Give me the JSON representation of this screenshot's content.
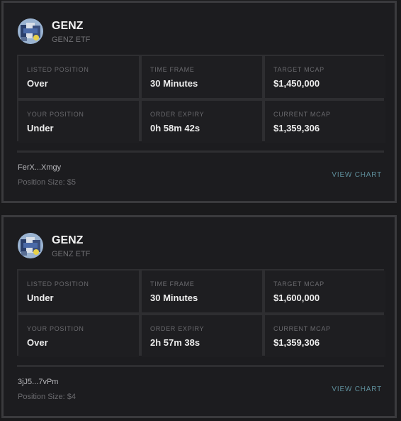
{
  "cards": [
    {
      "name": "GENZ",
      "subtitle": "GENZ ETF",
      "listed_position_label": "LISTED POSITION",
      "listed_position": "Over",
      "time_frame_label": "TIME FRAME",
      "time_frame": "30 Minutes",
      "target_mcap_label": "TARGET MCAP",
      "target_mcap": "$1,450,000",
      "your_position_label": "YOUR POSITION",
      "your_position": "Under",
      "order_expiry_label": "ORDER EXPIRY",
      "order_expiry": "0h 58m 42s",
      "current_mcap_label": "CURRENT MCAP",
      "current_mcap": "$1,359,306",
      "wallet": "FerX...Xmgy",
      "position_size": "Position Size: $5",
      "view_chart": "VIEW CHART"
    },
    {
      "name": "GENZ",
      "subtitle": "GENZ ETF",
      "listed_position_label": "LISTED POSITION",
      "listed_position": "Under",
      "time_frame_label": "TIME FRAME",
      "time_frame": "30 Minutes",
      "target_mcap_label": "TARGET MCAP",
      "target_mcap": "$1,600,000",
      "your_position_label": "YOUR POSITION",
      "your_position": "Over",
      "order_expiry_label": "ORDER EXPIRY",
      "order_expiry": "2h 57m 38s",
      "current_mcap_label": "CURRENT MCAP",
      "current_mcap": "$1,359,306",
      "wallet": "3jJ5...7vPm",
      "position_size": "Position Size: $4",
      "view_chart": "VIEW CHART"
    }
  ],
  "colors": {
    "background": "#1a1a1c",
    "card_border": "#3a3a3d",
    "link": "#5f8f9c"
  },
  "icons": {
    "avatar": "token-avatar-icon"
  }
}
